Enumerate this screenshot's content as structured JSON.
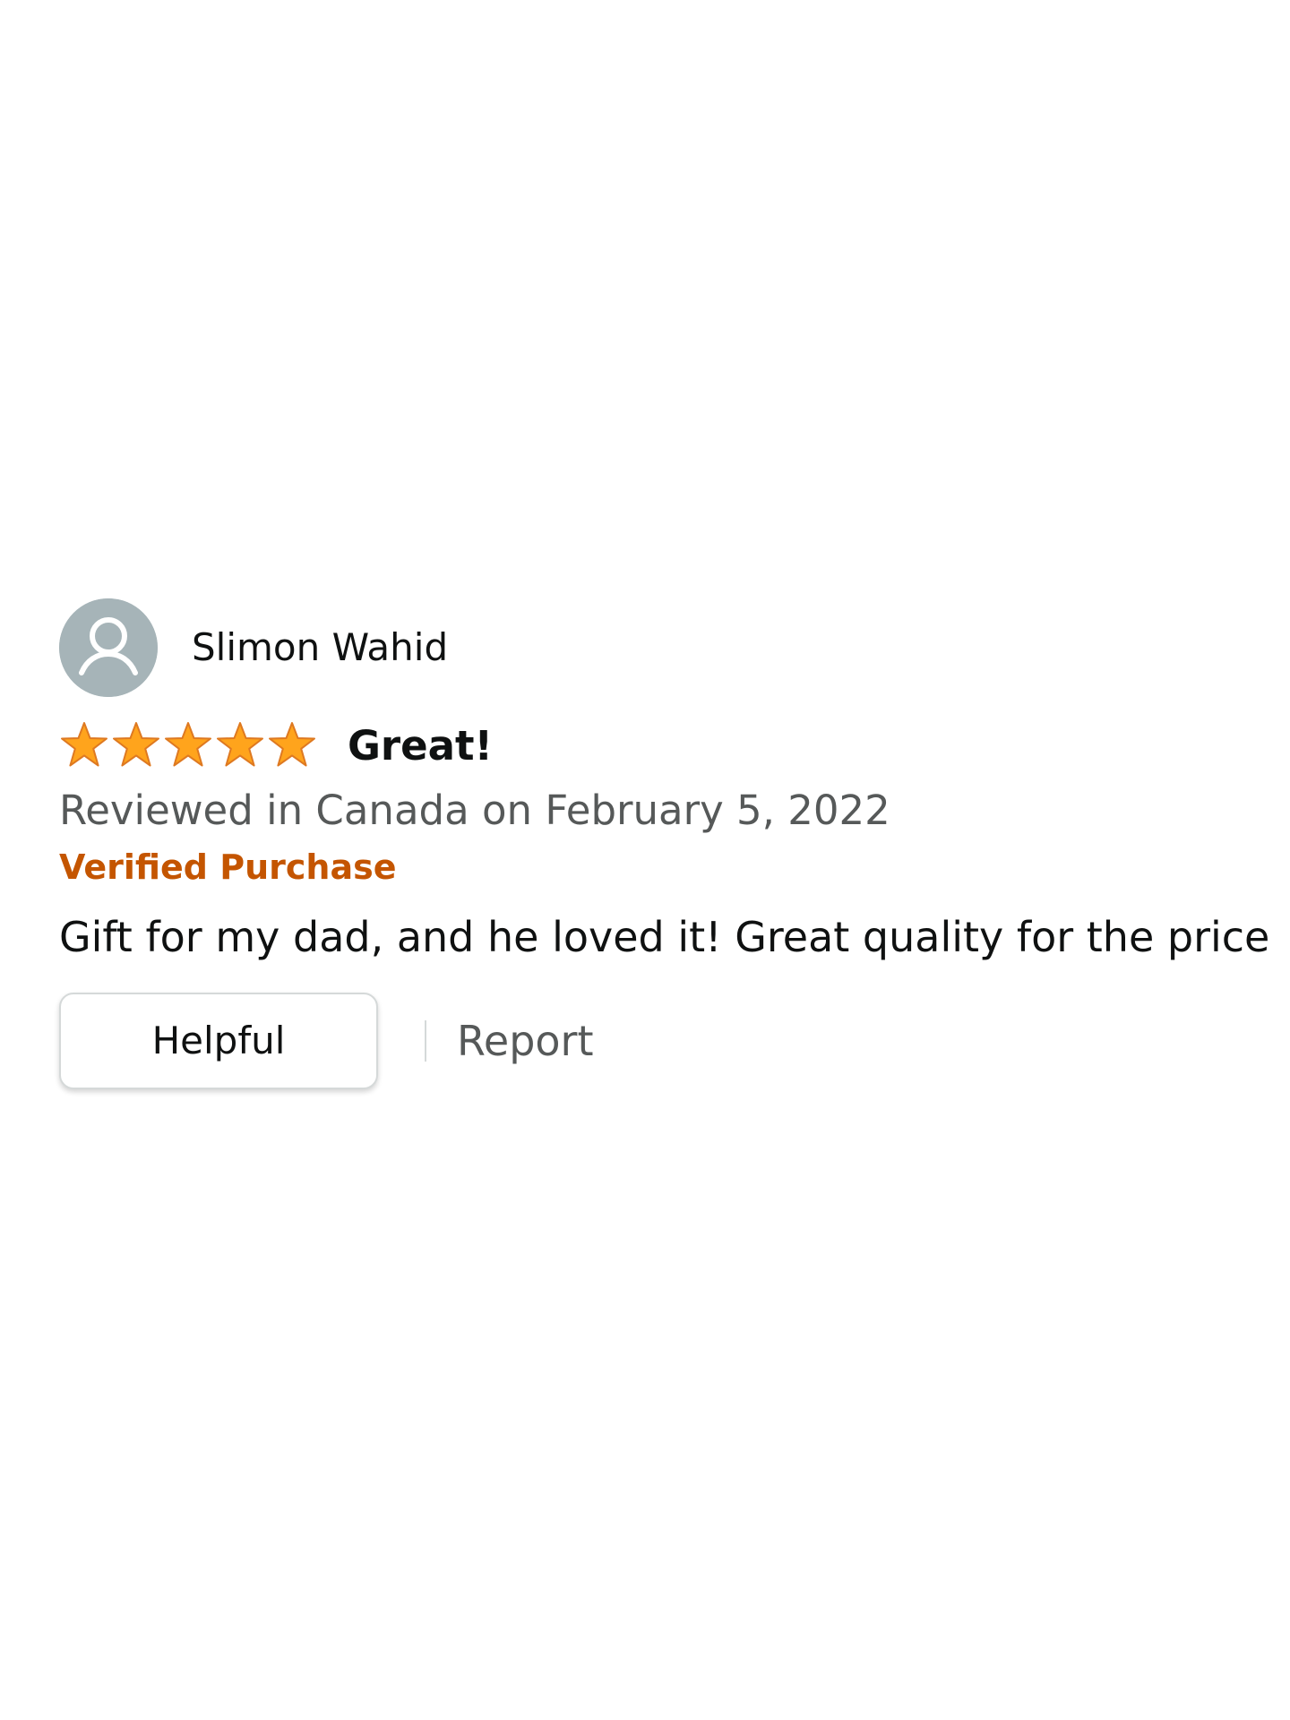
{
  "review": {
    "reviewer_name": "Slimon Wahid",
    "rating": 5,
    "max_rating": 5,
    "title": "Great!",
    "date_line": "Reviewed in Canada on February 5, 2022",
    "verified_label": "Verified Purchase",
    "body": "Gift for my dad, and he loved it! Great quality for the price",
    "helpful_label": "Helpful",
    "report_label": "Report"
  },
  "icons": {
    "avatar": "default-user-avatar",
    "star": "filled-star"
  },
  "colors": {
    "star": "#ffa41c",
    "star_outline": "#de7921",
    "verified": "#c45500",
    "secondary_text": "#565959",
    "avatar_background": "#a6b4b8"
  }
}
